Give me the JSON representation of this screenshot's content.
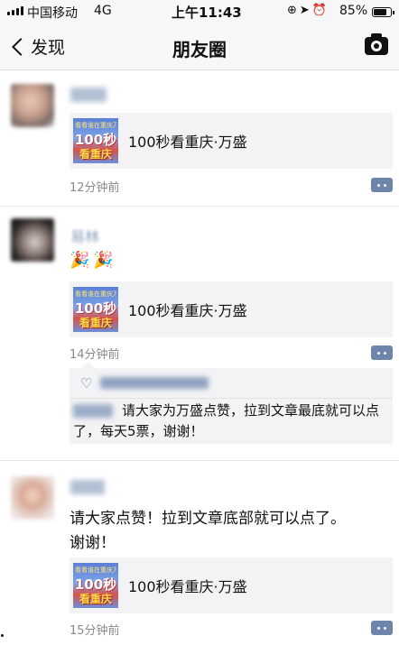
{
  "status_bar": {
    "carrier": "中国移动",
    "network": "4G",
    "time": "上午11:43",
    "icons": [
      "lock-rotation-icon",
      "location-arrow-icon",
      "alarm-icon"
    ],
    "battery_percent_text": "85%",
    "battery_level": 0.85
  },
  "nav": {
    "back_label": "发现",
    "title": "朋友圈",
    "camera_icon": "camera-icon"
  },
  "posts": [
    {
      "link_card": {
        "thumb_top": "看看谁在重庆万盛",
        "thumb_number": "100秒",
        "thumb_city": "看重庆",
        "title": "100秒看重庆·万盛"
      },
      "time": "12分钟前"
    },
    {
      "name": "易林",
      "emojis": "🎉🎉",
      "link_card": {
        "thumb_top": "看看谁在重庆万盛",
        "thumb_number": "100秒",
        "thumb_city": "看重庆",
        "title": "100秒看重庆·万盛"
      },
      "time": "14分钟前",
      "comment": {
        "text": "请大家为万盛点赞，拉到文章最底就可以点了，每天5票，谢谢！"
      }
    },
    {
      "text_line1": "请大家点赞！拉到文章底部就可以点了。",
      "text_line2": "谢谢！",
      "link_card": {
        "thumb_top": "看看谁在重庆万盛",
        "thumb_number": "100秒",
        "thumb_city": "看重庆",
        "title": "100秒看重庆·万盛"
      },
      "time": "15分钟前"
    }
  ],
  "colors": {
    "nav_bg": "#f7f7f7",
    "card_bg": "#f3f3f5",
    "link_blue": "#5b6f93",
    "time_gray": "#8a8a8a"
  }
}
